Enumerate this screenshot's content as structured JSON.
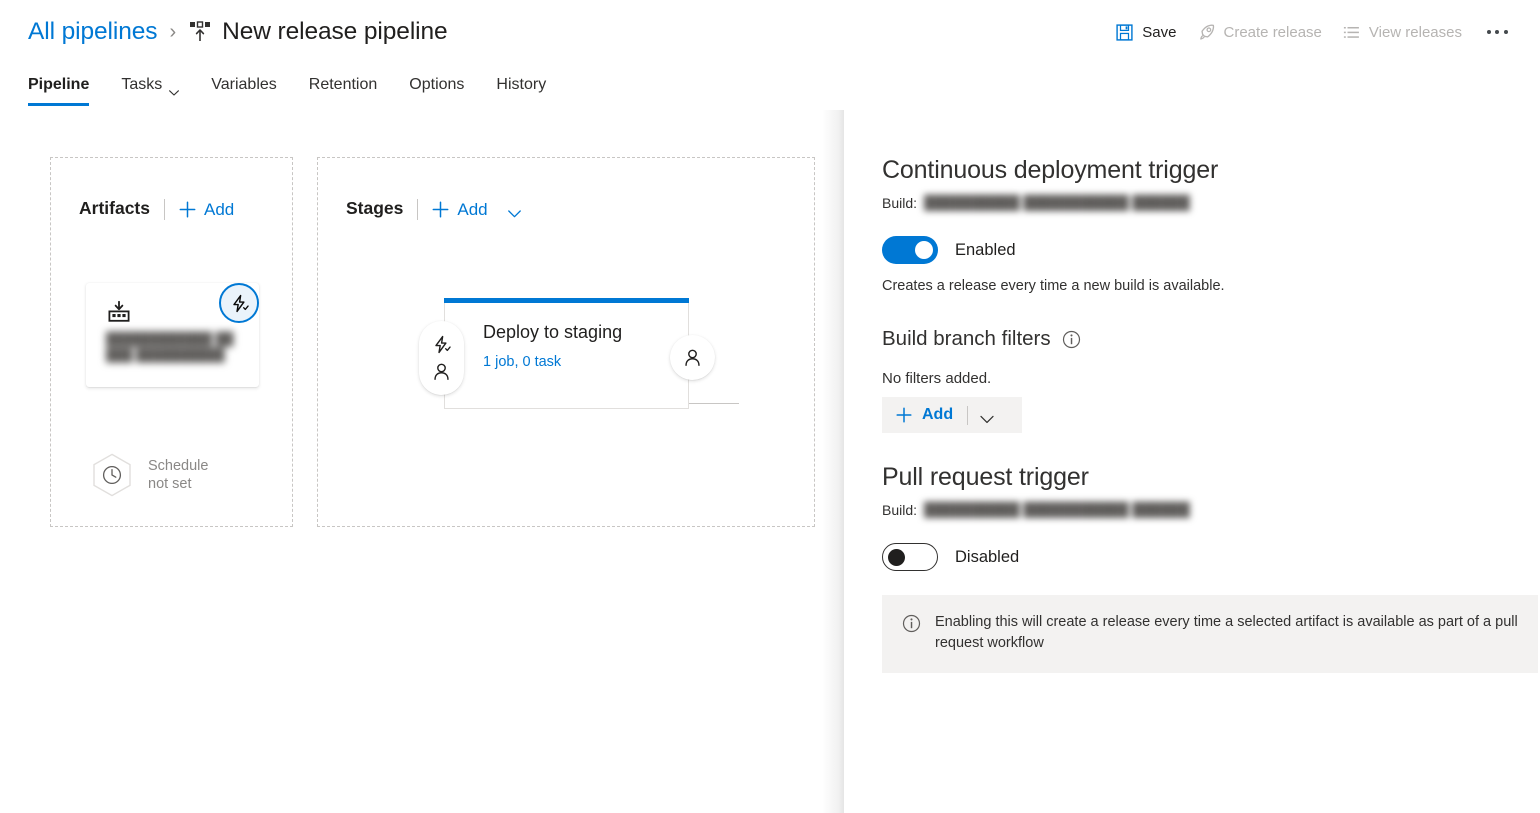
{
  "header": {
    "breadcrumb_link": "All pipelines",
    "breadcrumb_separator": "›",
    "title": "New release pipeline",
    "pipeline_icon": "release-pipeline-icon",
    "toolbar": [
      {
        "label": "Save",
        "icon": "save-icon",
        "enabled": true
      },
      {
        "label": "Create release",
        "icon": "rocket-icon",
        "enabled": false
      },
      {
        "label": "View releases",
        "icon": "list-icon",
        "enabled": false
      }
    ],
    "more_menu_icon": "ellipsis-icon"
  },
  "tabs": [
    {
      "label": "Pipeline",
      "active": true,
      "has_chevron": false
    },
    {
      "label": "Tasks",
      "active": false,
      "has_chevron": true
    },
    {
      "label": "Variables",
      "active": false,
      "has_chevron": false
    },
    {
      "label": "Retention",
      "active": false,
      "has_chevron": false
    },
    {
      "label": "Options",
      "active": false,
      "has_chevron": false
    },
    {
      "label": "History",
      "active": false,
      "has_chevron": false
    }
  ],
  "canvas": {
    "artifacts": {
      "title": "Artifacts",
      "add_label": "Add",
      "card": {
        "icon": "build-artifact-icon",
        "name_redacted": "████████████ █████ ██████████",
        "trigger_badge_icon": "continuous-deployment-trigger-icon"
      },
      "schedule": {
        "icon": "clock-icon",
        "line1": "Schedule",
        "line2": "not set"
      }
    },
    "stages": {
      "title": "Stages",
      "add_label": "Add",
      "stage": {
        "name": "Deploy to staging",
        "summary": "1 job, 0 task",
        "accent_color": "#0078d4",
        "pre_deployment_icons": [
          "lightning-trigger-icon",
          "person-approval-icon"
        ],
        "post_deployment_icons": [
          "person-approval-icon"
        ]
      }
    }
  },
  "panel": {
    "cd_trigger": {
      "heading": "Continuous deployment trigger",
      "build_label": "Build:",
      "build_value_redacted": "██████████ ███████████ ██████",
      "toggle_state": "on",
      "toggle_label": "Enabled",
      "helper_text": "Creates a release every time a new build is available."
    },
    "branch_filters": {
      "heading": "Build branch filters",
      "info_icon": "info-icon",
      "empty_text": "No filters added.",
      "add_label": "Add"
    },
    "pr_trigger": {
      "heading": "Pull request trigger",
      "build_label": "Build:",
      "build_value_redacted": "██████████ ███████████ ██████",
      "toggle_state": "off",
      "toggle_label": "Disabled",
      "info_message": "Enabling this will create a release every time a selected artifact is available as part of a pull request workflow"
    }
  },
  "colors": {
    "accent": "#0078d4",
    "text": "#201f1e",
    "muted": "#605e5c",
    "disabled": "#b6b4b2",
    "surface_alt": "#f3f2f1",
    "border": "#c8c6c4"
  }
}
